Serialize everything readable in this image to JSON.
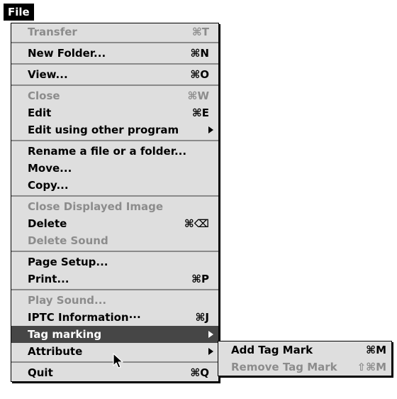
{
  "menubar": {
    "title": "File"
  },
  "menu": {
    "transfer": {
      "label": "Transfer",
      "shortcut": "⌘T"
    },
    "new_folder": {
      "label": "New Folder...",
      "shortcut": "⌘N"
    },
    "view": {
      "label": "View...",
      "shortcut": "⌘O"
    },
    "close": {
      "label": "Close",
      "shortcut": "⌘W"
    },
    "edit": {
      "label": "Edit",
      "shortcut": "⌘E"
    },
    "edit_other": {
      "label": "Edit using other program"
    },
    "rename": {
      "label": "Rename a file or a folder..."
    },
    "move": {
      "label": "Move..."
    },
    "copy": {
      "label": "Copy..."
    },
    "close_image": {
      "label": "Close Displayed Image"
    },
    "delete": {
      "label": "Delete",
      "shortcut": "⌘⌫"
    },
    "delete_sound": {
      "label": "Delete Sound"
    },
    "page_setup": {
      "label": "Page Setup..."
    },
    "print": {
      "label": "Print...",
      "shortcut": "⌘P"
    },
    "play_sound": {
      "label": "Play Sound..."
    },
    "iptc": {
      "label": "IPTC Information···",
      "shortcut": "⌘J"
    },
    "tag_marking": {
      "label": "Tag marking"
    },
    "attribute": {
      "label": "Attribute"
    },
    "quit": {
      "label": "Quit",
      "shortcut": "⌘Q"
    }
  },
  "submenu": {
    "add_tag": {
      "label": "Add Tag Mark",
      "shortcut": "⌘M"
    },
    "remove_tag": {
      "label": "Remove Tag Mark",
      "shortcut": "⇧⌘M"
    }
  },
  "colors": {
    "menu_bg": "#dedede",
    "highlight_bg": "#464646",
    "disabled_text": "#8c8c8c",
    "separator": "#8a8a8a"
  }
}
